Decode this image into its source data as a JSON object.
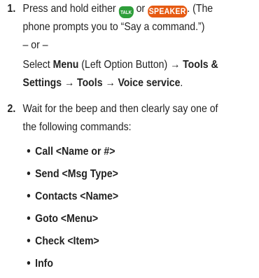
{
  "step1": {
    "number": "1.",
    "line1_pre": "Press and hold either",
    "talk_key": "TALK",
    "or_word": "or",
    "speaker_key": "SPEAKER",
    "line1_post": ". (The",
    "line2": "phone prompts you to “Say a command.”)",
    "or_separator": "– or –",
    "select_word": "Select",
    "menu_label": "Menu",
    "left_option": "(Left Option Button)",
    "arrow1": "→",
    "tools_settings": "Tools &",
    "settings_line_start": "Settings",
    "arrow2": "→",
    "tools": "Tools",
    "arrow3": "→",
    "voice_service": "Voice service",
    "period": "."
  },
  "step2": {
    "number": "2.",
    "line1": "Wait for the beep and then clearly say one of",
    "line2": "the following commands:",
    "commands": [
      "Call <Name or #>",
      "Send <Msg Type>",
      "Contacts <Name>",
      "Goto <Menu>",
      "Check <Item>",
      "Info"
    ]
  },
  "colors": {
    "talk_key": "#2e9e3a",
    "speaker_key": "#e65a12",
    "text": "#222222"
  }
}
